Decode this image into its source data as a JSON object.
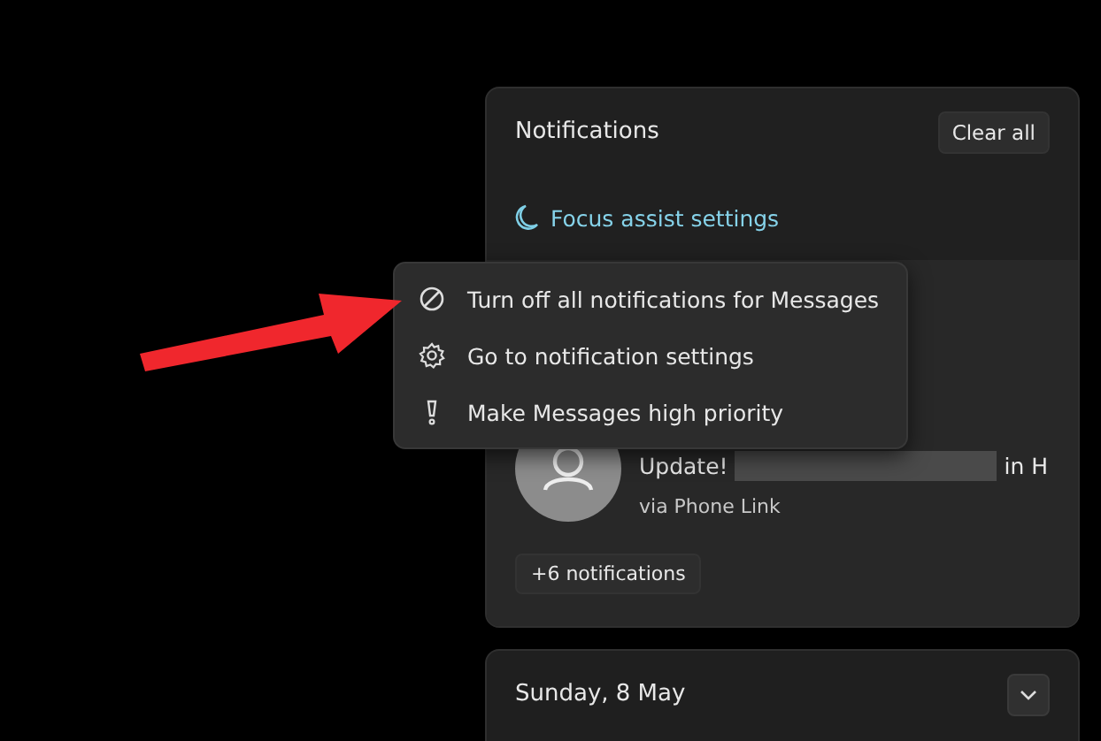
{
  "notifications_panel": {
    "title": "Notifications",
    "clear_button": "Clear all",
    "focus_assist_link": "Focus assist settings",
    "notification": {
      "message_start": "Update!",
      "message_end": "in H",
      "source": "via Phone Link"
    },
    "more_button": "+6 notifications"
  },
  "context_menu": {
    "items": [
      {
        "kind": "block",
        "label": "Turn off all notifications for Messages"
      },
      {
        "kind": "gear",
        "label": "Go to notification settings"
      },
      {
        "kind": "priority",
        "label": "Make Messages high priority"
      }
    ]
  },
  "calendar": {
    "date": "Sunday, 8 May",
    "expanded": false
  }
}
